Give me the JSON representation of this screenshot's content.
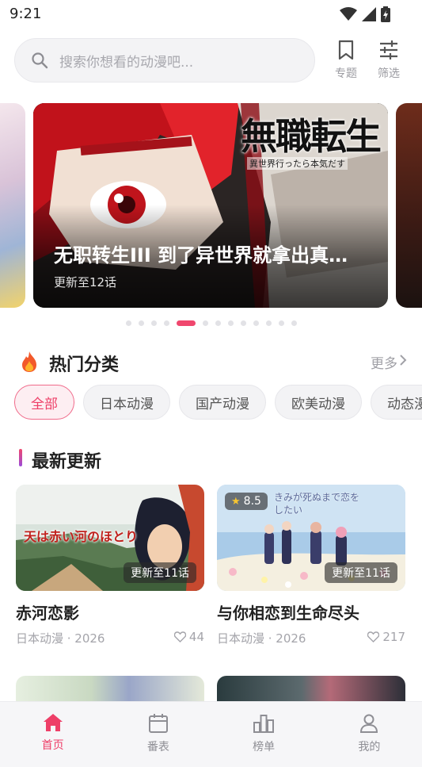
{
  "status_bar": {
    "time": "9:21"
  },
  "search": {
    "placeholder": "搜索你想看的动漫吧..."
  },
  "header_actions": [
    {
      "label": "专题",
      "icon": "bookmark-icon"
    },
    {
      "label": "筛选",
      "icon": "filter-sliders-icon"
    }
  ],
  "banner": {
    "title": "无职转生III 到了异世界就拿出真…",
    "subtitle": "更新至12话",
    "logo_text": "無職転生",
    "logo_subtext": "異世界行ったら本気だす",
    "dot_count": 13,
    "active_dot": 4
  },
  "hot_categories": {
    "title": "热门分类",
    "more": "更多",
    "chips": [
      "全部",
      "日本动漫",
      "国产动漫",
      "欧美动漫",
      "动态漫"
    ],
    "active_index": 0
  },
  "latest": {
    "title": "最新更新",
    "cards": [
      {
        "title": "赤河恋影",
        "category_year": "日本动漫 · 2026",
        "likes": "44",
        "episode": "更新至11话",
        "thumb_text": "天は赤い河のほとり"
      },
      {
        "title": "与你相恋到生命尽头",
        "category_year": "日本动漫 · 2026",
        "likes": "217",
        "episode": "更新至11话",
        "rating": "8.5",
        "thumb_text": "きみが死ぬまで恋をしたい"
      }
    ]
  },
  "bottom_nav": [
    {
      "label": "首页",
      "icon": "home-icon",
      "active": true
    },
    {
      "label": "番表",
      "icon": "calendar-icon",
      "active": false
    },
    {
      "label": "榜单",
      "icon": "ranking-icon",
      "active": false
    },
    {
      "label": "我的",
      "icon": "profile-icon",
      "active": false
    }
  ],
  "colors": {
    "accent": "#ee3f68",
    "muted": "#a0a0a6"
  }
}
